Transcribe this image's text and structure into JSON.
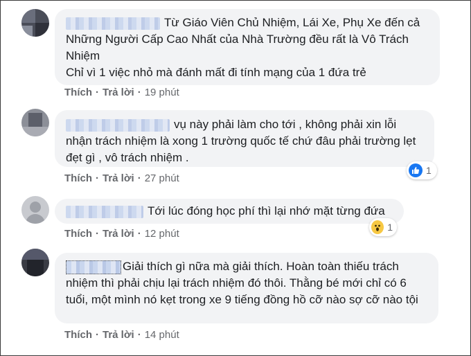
{
  "comments": [
    {
      "text": "Từ Giáo Viên Chủ Nhiệm, Lái Xe, Phụ Xe đến cả Những Người Cấp Cao Nhất của Nhà Trường đều rất là Vô Trách Nhiệm\nChỉ vì 1 việc nhỏ mà đánh mất đi tính mạng của 1 đứa trẻ",
      "like": "Thích",
      "reply": "Trả lời",
      "time": "19 phút"
    },
    {
      "text": "vụ này phải làm cho tới , không phải xin lỗi nhận trách nhiệm là xong 1 trường quốc tế chứ đâu phải trường lẹt đẹt gì , vô trách nhiệm .",
      "like": "Thích",
      "reply": "Trả lời",
      "time": "27 phút",
      "reaction": {
        "icon": "like-icon",
        "count": "1"
      }
    },
    {
      "text": "Tới lúc đóng học phí thì lại nhớ mặt từng đứa",
      "like": "Thích",
      "reply": "Trả lời",
      "time": "12 phút",
      "reaction": {
        "icon": "wow-icon",
        "count": "1"
      }
    },
    {
      "text": "Giải thích gì nữa mà giải thích. Hoàn toàn thiếu trách nhiệm thì phải chịu lại trách nhiệm đó thôi. Thằng bé mới chỉ có 6 tuổi, một mình nó kẹt trong xe 9 tiếng đồng hồ cỡ nào sợ cỡ nào tội",
      "like": "Thích",
      "reply": "Trả lời",
      "time": "14 phút"
    }
  ],
  "colors": {
    "bubble": "#f2f3f5",
    "text": "#1c1e21",
    "meta": "#65676b",
    "like": "#1877f2",
    "wow": "#f7c843"
  }
}
